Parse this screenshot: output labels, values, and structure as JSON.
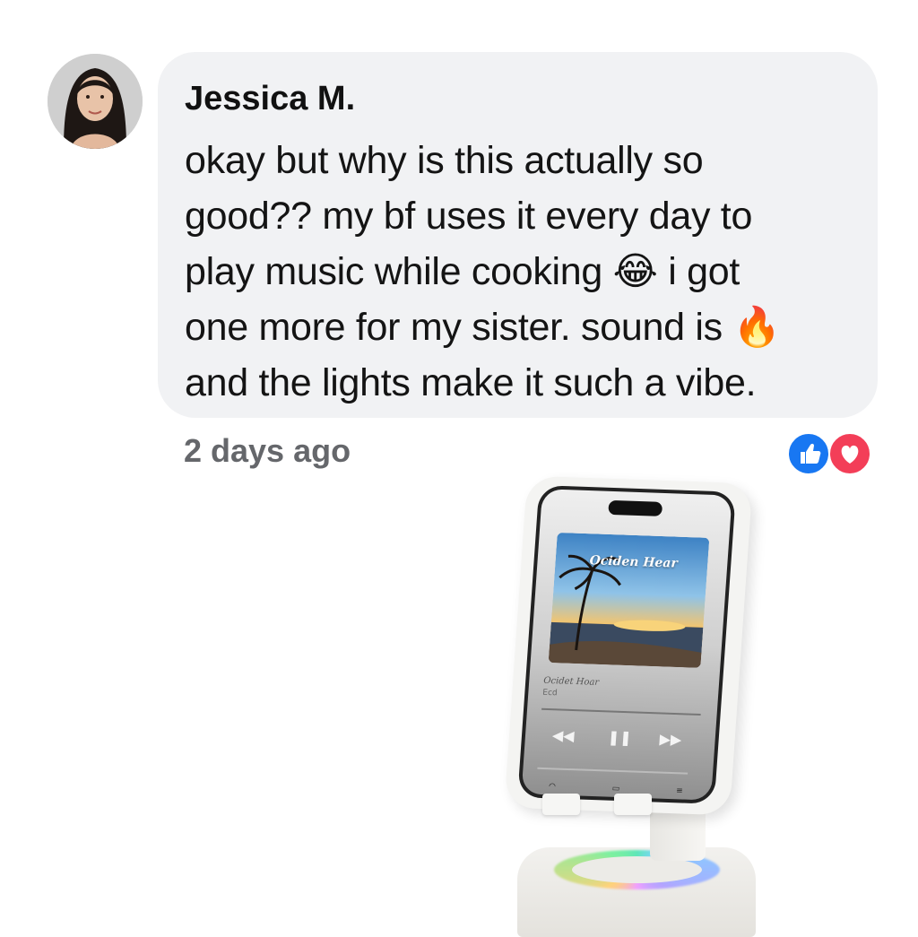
{
  "comment": {
    "author": "Jessica M.",
    "body_lines": [
      "okay but why is this actually so",
      "good?? my bf uses it every day to",
      "play music while cooking 😂 i got",
      "one more for my sister. sound is 🔥",
      "and the lights make it such a vibe."
    ],
    "timestamp": "2 days ago",
    "reactions": [
      "like-icon",
      "love-icon"
    ]
  },
  "product": {
    "album_title": "Ociden Hear",
    "track_title": "Ocidet Hoar",
    "track_artist": "Ecd",
    "ring_colors": [
      "#5ee6b8",
      "#7fd4ff",
      "#b3a4ff",
      "#f0a0ff",
      "#ffd27a"
    ]
  },
  "colors": {
    "bubble": "#f1f2f4",
    "like": "#1877f2",
    "love": "#f33e58",
    "meta_text": "#65676b"
  }
}
